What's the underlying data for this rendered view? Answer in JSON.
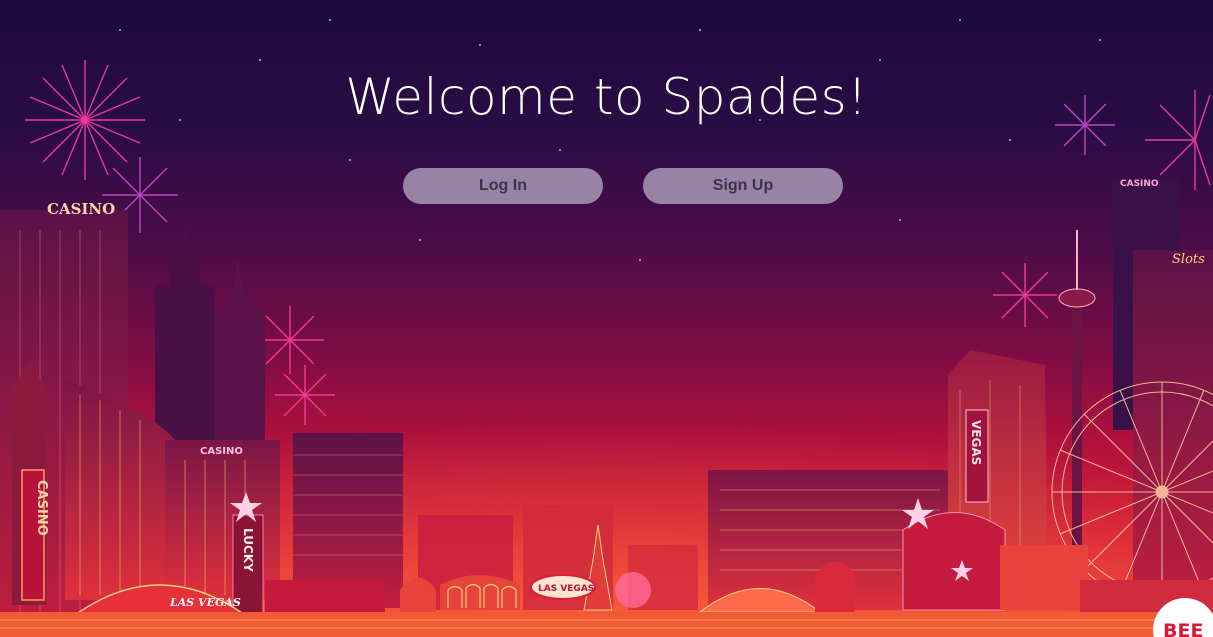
{
  "header": {
    "title": "Welcome to Spades!"
  },
  "auth": {
    "login_label": "Log In",
    "signup_label": "Sign Up"
  },
  "background": {
    "casino_sign": "CASINO",
    "casino_tower_sign": "CASINO",
    "casino_vertical_sign": "CASINO",
    "casino_small_sign": "CASINO",
    "lucky_sign": "LUCKY",
    "vegas_tower_sign": "VEGAS",
    "slots_sign": "Slots",
    "las_vegas_sign": "LAS VEGAS",
    "las_vegas_dome_sign": "LAS VEGAS",
    "badge_text": "BEE"
  },
  "colors": {
    "sky_top": "#1c0a3d",
    "sky_bottom": "#f04a38",
    "neon_pink": "#ff3fa4",
    "button_fill": "#b2a5c0",
    "button_text": "#3d3346"
  }
}
